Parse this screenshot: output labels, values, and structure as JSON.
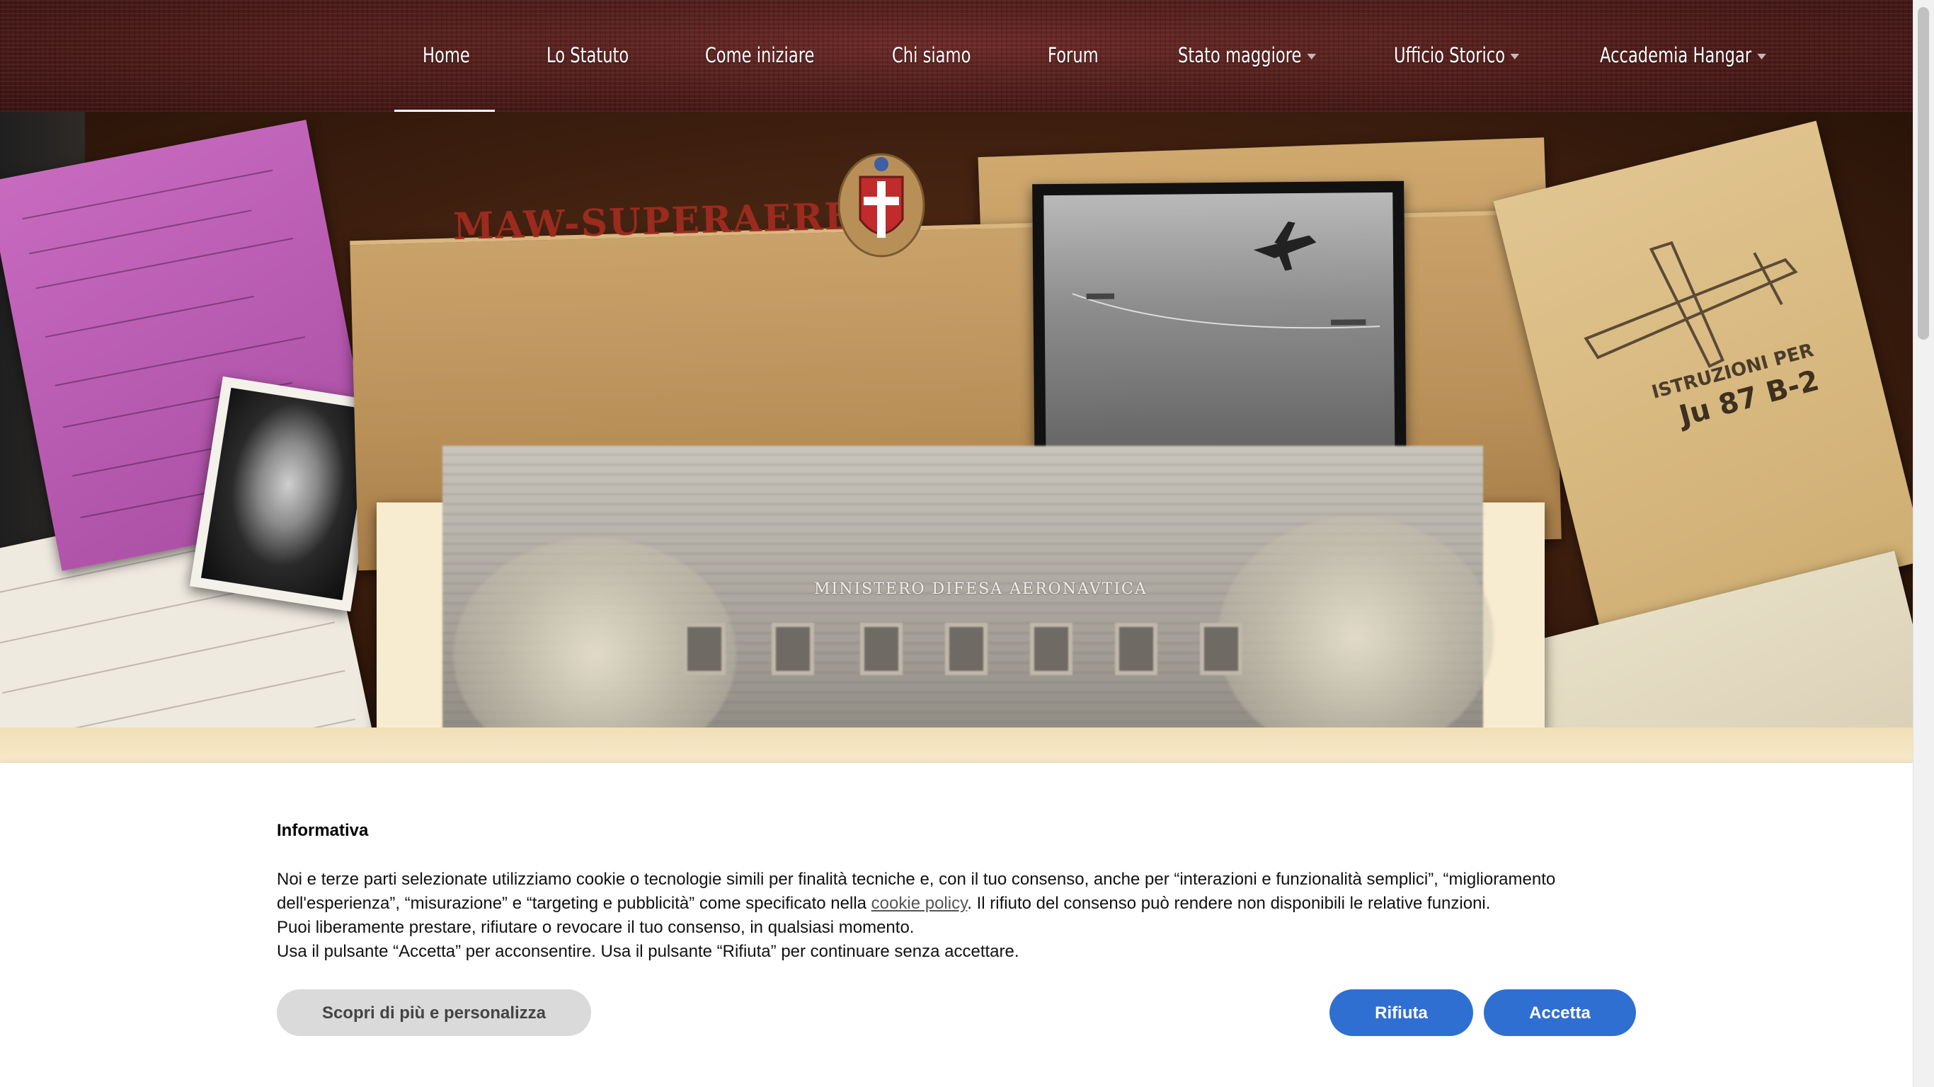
{
  "nav": {
    "items": [
      {
        "label": "Home",
        "active": true,
        "has_dropdown": false
      },
      {
        "label": "Lo Statuto",
        "active": false,
        "has_dropdown": false
      },
      {
        "label": "Come iniziare",
        "active": false,
        "has_dropdown": false
      },
      {
        "label": "Chi siamo",
        "active": false,
        "has_dropdown": false
      },
      {
        "label": "Forum",
        "active": false,
        "has_dropdown": false
      },
      {
        "label": "Stato maggiore",
        "active": false,
        "has_dropdown": true
      },
      {
        "label": "Ufficio Storico",
        "active": false,
        "has_dropdown": true
      },
      {
        "label": "Accademia Hangar",
        "active": false,
        "has_dropdown": true
      }
    ]
  },
  "hero": {
    "folder_title": "MAW-SUPERAEREO",
    "manual_title": "ISTRUZIONI PER",
    "manual_subtitle": "Ju 87 B-2",
    "building_label": "MINISTERO DIFESA AERONAVTICA"
  },
  "cookie": {
    "title": "Informativa",
    "text_part1": "Noi e terze parti selezionate utilizziamo cookie o tecnologie simili per finalità tecniche e, con il tuo consenso, anche per “interazioni e funzionalità semplici”, “miglioramento dell'esperienza”, “misurazione” e “targeting e pubblicità” come specificato nella ",
    "link_text": "cookie policy",
    "text_part2": ". Il rifiuto del consenso può rendere non disponibili le relative funzioni.",
    "line2": "Puoi liberamente prestare, rifiutare o revocare il tuo consenso, in qualsiasi momento.",
    "line3": "Usa il pulsante “Accetta” per acconsentire. Usa il pulsante “Rifiuta” per continuare senza accettare.",
    "learn_more_label": "Scopri di più e personalizza",
    "reject_label": "Rifiuta",
    "accept_label": "Accetta"
  },
  "colors": {
    "navbar": "#4a1a19",
    "button_primary": "#2f6fd1",
    "button_secondary": "#dadada",
    "folder_title": "#9a2b1e"
  }
}
